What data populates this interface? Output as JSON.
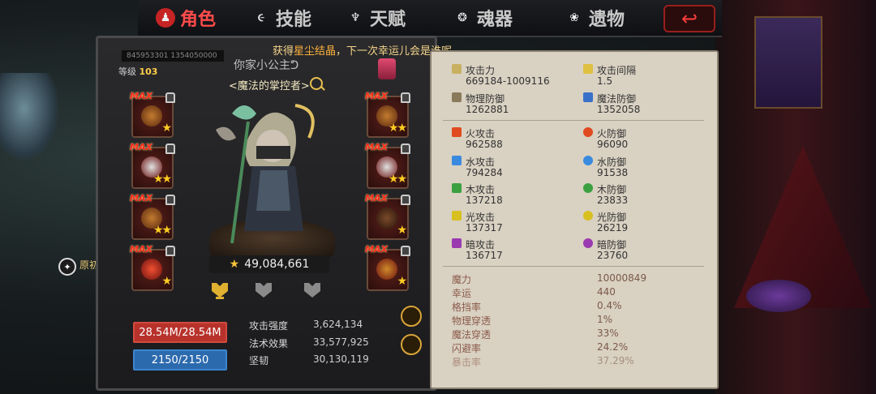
{
  "tabs": [
    {
      "label": "角色",
      "icon": "character-icon",
      "active": true
    },
    {
      "label": "技能",
      "icon": "skill-icon",
      "active": false
    },
    {
      "label": "天赋",
      "icon": "talent-icon",
      "active": false
    },
    {
      "label": "魂器",
      "icon": "soul-vessel-icon",
      "active": false
    },
    {
      "label": "遗物",
      "icon": "relic-icon",
      "active": false
    }
  ],
  "ticker": {
    "prefix": "获得",
    "highlight": "星尘结晶",
    "suffix": "，下一次幸运儿会是谁呢~"
  },
  "player": {
    "uid": "845953301 1354050000",
    "level_label": "等级",
    "level": "103",
    "name": "你家小公主ᕤ",
    "title": "<魔法的掌控者>",
    "power": "49,084,661"
  },
  "equipment": {
    "max_label": "MAX",
    "left": [
      {
        "stars": "★"
      },
      {
        "stars": "★★"
      },
      {
        "stars": "★★"
      },
      {
        "stars": "★"
      }
    ],
    "right": [
      {
        "stars": "★★"
      },
      {
        "stars": "★★"
      },
      {
        "stars": "★"
      },
      {
        "stars": "★"
      }
    ]
  },
  "bars": {
    "hp": "28.54M/28.54M",
    "mp": "2150/2150"
  },
  "attributes": [
    {
      "label": "攻击强度",
      "value": "3,624,134"
    },
    {
      "label": "法术效果",
      "value": "33,577,925"
    },
    {
      "label": "坚韧",
      "value": "30,130,119"
    }
  ],
  "left_side": {
    "label": "原初"
  },
  "stats": {
    "primary": [
      {
        "label": "攻击力",
        "value": "669184-1009116",
        "icon": "sword-icon",
        "color": "#c8b060"
      },
      {
        "label": "攻击间隔",
        "value": "1.5",
        "icon": "quill-icon",
        "color": "#e0c040"
      },
      {
        "label": "物理防御",
        "value": "1262881",
        "icon": "shield-sword-icon",
        "color": "#8a7a5a"
      },
      {
        "label": "魔法防御",
        "value": "1352058",
        "icon": "magic-shield-icon",
        "color": "#3a70c8"
      }
    ],
    "elements": [
      {
        "label": "火攻击",
        "value": "962588",
        "icon": "fire-attack-icon",
        "color": "#e04a20"
      },
      {
        "label": "火防御",
        "value": "96090",
        "icon": "fire-defense-icon",
        "color": "#e04a20"
      },
      {
        "label": "水攻击",
        "value": "794284",
        "icon": "water-attack-icon",
        "color": "#3a8ae0"
      },
      {
        "label": "水防御",
        "value": "91538",
        "icon": "water-defense-icon",
        "color": "#3a8ae0"
      },
      {
        "label": "木攻击",
        "value": "137218",
        "icon": "wood-attack-icon",
        "color": "#3aa040"
      },
      {
        "label": "木防御",
        "value": "23833",
        "icon": "wood-defense-icon",
        "color": "#3aa040"
      },
      {
        "label": "光攻击",
        "value": "137317",
        "icon": "light-attack-icon",
        "color": "#d8c020"
      },
      {
        "label": "光防御",
        "value": "26219",
        "icon": "light-defense-icon",
        "color": "#d8c020"
      },
      {
        "label": "暗攻击",
        "value": "136717",
        "icon": "dark-attack-icon",
        "color": "#9a3ab0"
      },
      {
        "label": "暗防御",
        "value": "23760",
        "icon": "dark-defense-icon",
        "color": "#9a3ab0"
      }
    ],
    "misc": [
      {
        "label": "魔力",
        "value": "10000849"
      },
      {
        "label": "幸运",
        "value": "440"
      },
      {
        "label": "格挡率",
        "value": "0.4%"
      },
      {
        "label": "物理穿透",
        "value": "1%"
      },
      {
        "label": "魔法穿透",
        "value": "33%"
      },
      {
        "label": "闪避率",
        "value": "24.2%"
      },
      {
        "label": "暴击率",
        "value": "37.29%"
      }
    ]
  }
}
